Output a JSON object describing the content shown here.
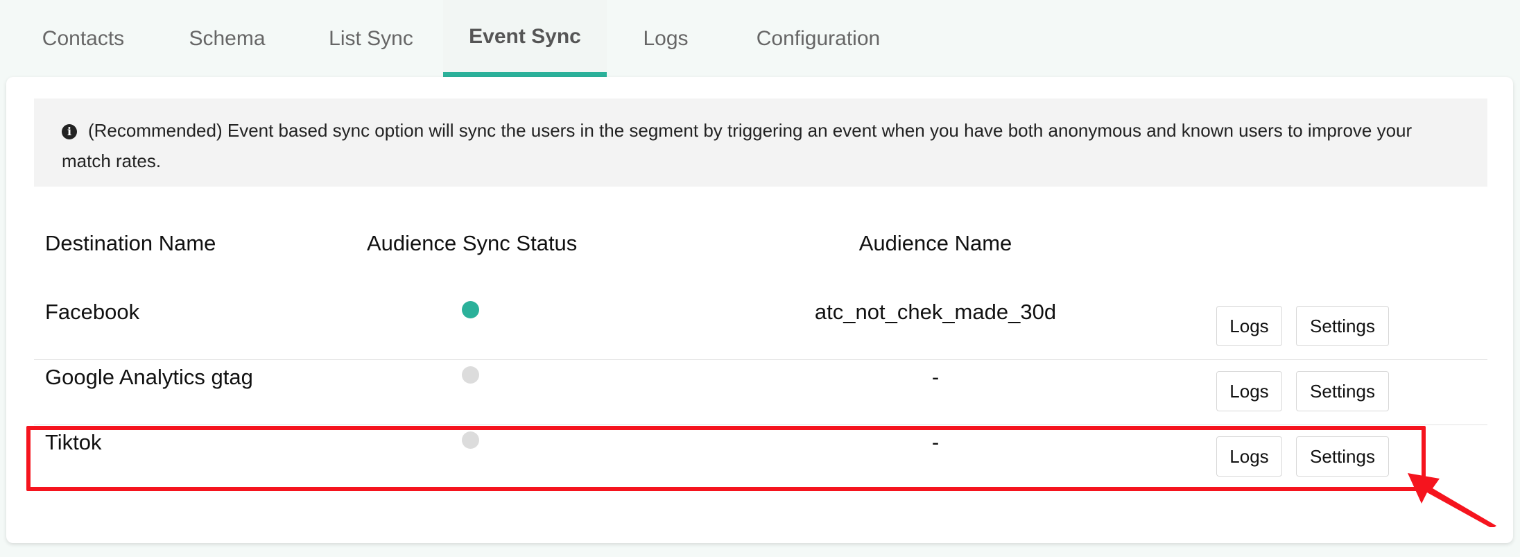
{
  "tabs": [
    {
      "label": "Contacts",
      "active": false
    },
    {
      "label": "Schema",
      "active": false
    },
    {
      "label": "List Sync",
      "active": false
    },
    {
      "label": "Event Sync",
      "active": true
    },
    {
      "label": "Logs",
      "active": false
    },
    {
      "label": "Configuration",
      "active": false
    }
  ],
  "info": {
    "icon": "info-icon",
    "text": "(Recommended) Event based sync option will sync the users in the segment by triggering an event when you have both anonymous and known users to improve your match rates."
  },
  "table": {
    "headers": {
      "destination": "Destination Name",
      "status": "Audience Sync Status",
      "audience": "Audience Name"
    },
    "rows": [
      {
        "destination": "Facebook",
        "status": "active",
        "audience": "atc_not_chek_made_30d",
        "logs_label": "Logs",
        "settings_label": "Settings"
      },
      {
        "destination": "Google Analytics gtag",
        "status": "inactive",
        "audience": "-",
        "logs_label": "Logs",
        "settings_label": "Settings"
      },
      {
        "destination": "Tiktok",
        "status": "inactive",
        "audience": "-",
        "logs_label": "Logs",
        "settings_label": "Settings"
      }
    ]
  },
  "colors": {
    "accent": "#2bb19a",
    "status_active": "#2bb19a",
    "status_inactive": "#dcdcdc",
    "annotation": "#f5141e"
  }
}
